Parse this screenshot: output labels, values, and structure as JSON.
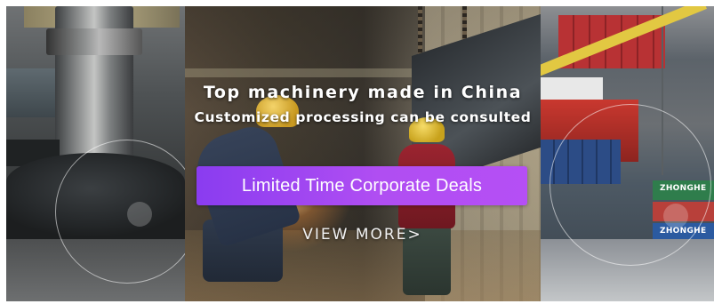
{
  "banner": {
    "headline": "Top machinery made in China",
    "subheadline": "Customized processing can be consulted",
    "cta_label": "Limited Time Corporate Deals",
    "view_more_label": "VIEW MORE>",
    "cta_gradient_start": "#8a3cf0",
    "cta_gradient_end": "#b54ff5"
  },
  "images": {
    "left": "machine-press-photo",
    "middle": "welding-workers-photo",
    "right": "shipping-port-photo"
  },
  "container_labels": {
    "green": "ZHONGHE",
    "blue": "ZHONGHE"
  }
}
